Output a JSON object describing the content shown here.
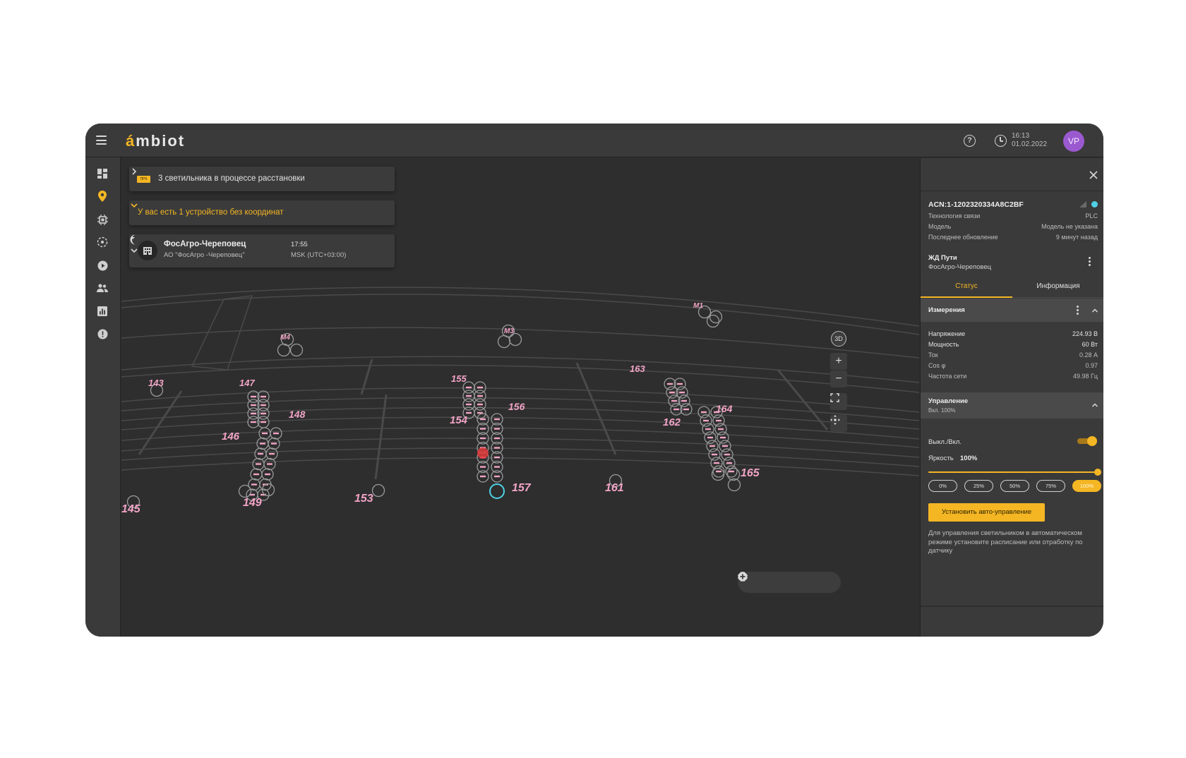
{
  "app": {
    "logo": {
      "accent": "á",
      "rest": "mbiot"
    },
    "clock": {
      "time": "16:13",
      "date": "01.02.2022"
    },
    "user_initials": "VP"
  },
  "sidebar": {
    "items": [
      {
        "name": "dashboard-icon",
        "active": false
      },
      {
        "name": "map-pin-icon",
        "active": true
      },
      {
        "name": "device-icon",
        "active": false
      },
      {
        "name": "zones-icon",
        "active": false
      },
      {
        "name": "play-icon",
        "active": false
      },
      {
        "name": "users-icon",
        "active": false
      },
      {
        "name": "reports-icon",
        "active": false
      },
      {
        "name": "alerts-icon",
        "active": false
      }
    ]
  },
  "map": {
    "placement_notice": {
      "badge": "ПРК",
      "text": "3 светильника в процессе расстановки"
    },
    "no_coords_notice": "У вас есть 1 устройство без координат",
    "site": {
      "name": "ФосАгро-Череповец",
      "org": "АО \"ФосАгро -Череповец\"",
      "time": "17:55",
      "timezone": "MSK (UTC+03:00)"
    },
    "controls": {
      "view3d": "3D",
      "zoom_in": "+",
      "zoom_out": "−"
    },
    "pole_labels": [
      "M1",
      "M3",
      "M4",
      "143",
      "145",
      "146",
      "147",
      "148",
      "149",
      "153",
      "154",
      "155",
      "156",
      "157",
      "161",
      "162",
      "163",
      "164",
      "165"
    ]
  },
  "panel": {
    "device_id": "ACN:1-1202320334A8C2BF",
    "fields": [
      {
        "key": "Технология связи",
        "value": "PLC"
      },
      {
        "key": "Модель",
        "value": "Модель не указана"
      },
      {
        "key": "Последнее обновление",
        "value": "9 минут назад"
      }
    ],
    "group": {
      "title": "ЖД Пути",
      "subtitle": "ФосАгро-Череповец"
    },
    "tabs": [
      "Статус",
      "Информация"
    ],
    "measurements": {
      "title": "Измерения",
      "rows": [
        {
          "key": "Напряжение",
          "value": "224.93 В",
          "bright": true
        },
        {
          "key": "Мощность",
          "value": "60 Вт",
          "bright": true
        },
        {
          "key": "Ток",
          "value": "0.28 А",
          "bright": false
        },
        {
          "key": "Cos φ",
          "value": "0.97",
          "bright": false
        },
        {
          "key": "Частота сети",
          "value": "49.98 Гц",
          "bright": false
        }
      ]
    },
    "control": {
      "title": "Управление",
      "subtitle": "Вкл. 100%",
      "toggle_label": "Выкл./Вкл.",
      "toggle_on": true,
      "brightness_label": "Яркость",
      "brightness_value": "100%",
      "brightness_level": 100,
      "presets": [
        "0%",
        "25%",
        "50%",
        "75%",
        "100%"
      ],
      "active_preset": "100%",
      "auto_button": "Установить авто-управление",
      "hint": "Для управления светильником в автоматическом режиме установите расписание или отработку по датчику"
    }
  },
  "colors": {
    "accent": "#f5b624",
    "online": "#4fd0e6",
    "avatar": "#9b59d0",
    "pole_label": "#f2a4c6",
    "selected_pole": "#4fd0e6",
    "faulty_pole": "#e23a3a"
  }
}
